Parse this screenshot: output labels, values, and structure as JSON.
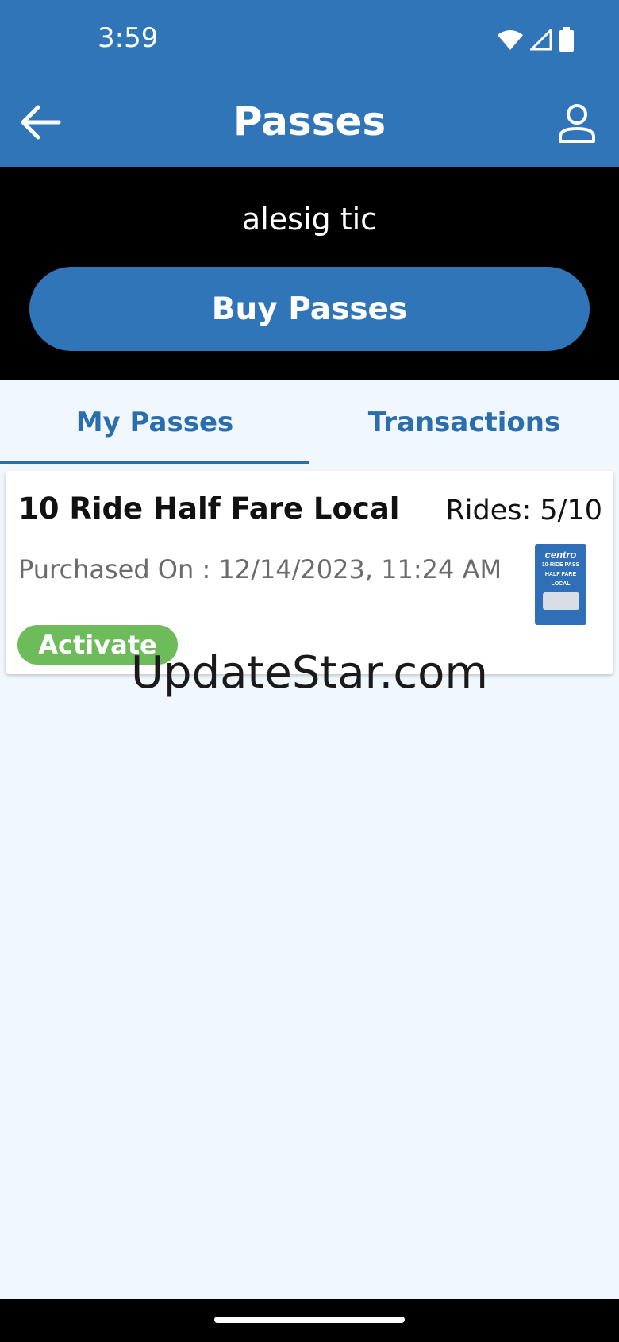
{
  "status_bar": {
    "time": "3:59",
    "icons": [
      "wifi-icon",
      "cell-signal-icon",
      "battery-icon"
    ]
  },
  "header": {
    "title": "Passes",
    "back_icon": "arrow-left-icon",
    "profile_icon": "person-icon"
  },
  "user": {
    "name": "alesig tic"
  },
  "buy_button": {
    "label": "Buy Passes"
  },
  "tabs": [
    {
      "label": "My Passes",
      "selected": true
    },
    {
      "label": "Transactions",
      "selected": false
    }
  ],
  "passes": [
    {
      "name": "10 Ride Half Fare Local",
      "rides": "Rides: 5/10",
      "purchased": "Purchased On : 12/14/2023, 11:24 AM",
      "activate_label": "Activate",
      "thumbnail": {
        "brand": "centro",
        "line1": "10-RIDE PASS",
        "line2": "HALF FARE",
        "line3": "LOCAL"
      }
    }
  ],
  "watermark": "UpdateStar.com",
  "colors": {
    "primary": "#3175b9",
    "tab_text": "#2a6ead",
    "activate": "#6dbb5a",
    "background": "#f0f7fd"
  }
}
